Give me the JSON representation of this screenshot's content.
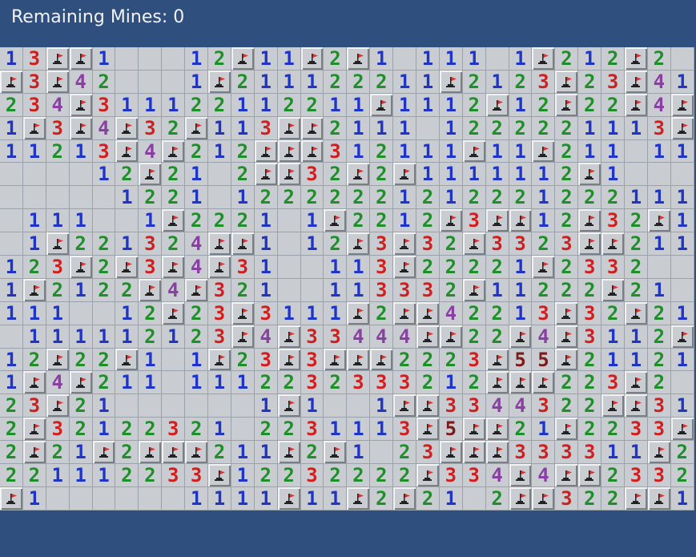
{
  "header": {
    "status_text": "Remaining Mines: 0"
  },
  "colors": {
    "background": "#2f4f7f",
    "cell_revealed": "#c9cdd1",
    "flag_red": "#e03030",
    "n1": "#1f35c7",
    "n2": "#1f8f2a",
    "n3": "#d01f1f",
    "n4": "#8a3fa3",
    "n5": "#7a1a1a"
  },
  "board": {
    "rows": 20,
    "cols": 30,
    "cells": [
      [
        "1",
        "3",
        "F",
        "F",
        "1",
        "",
        "",
        "",
        "1",
        "2",
        "F",
        "1",
        "1",
        "F",
        "2",
        "F",
        "1",
        "",
        "1",
        "1",
        "1",
        "",
        "1",
        "F",
        "2",
        "1",
        "2",
        "F",
        "2",
        ""
      ],
      [
        "F",
        "3",
        "F",
        "4",
        "2",
        "",
        "",
        "",
        "1",
        "F",
        "2",
        "1",
        "1",
        "1",
        "2",
        "2",
        "2",
        "1",
        "1",
        "F",
        "2",
        "1",
        "2",
        "3",
        "F",
        "2",
        "3",
        "F",
        "4",
        "1"
      ],
      [
        "2",
        "3",
        "4",
        "F",
        "3",
        "1",
        "1",
        "1",
        "2",
        "2",
        "1",
        "1",
        "2",
        "2",
        "1",
        "1",
        "F",
        "1",
        "1",
        "1",
        "2",
        "F",
        "1",
        "2",
        "F",
        "2",
        "2",
        "F",
        "4",
        "F"
      ],
      [
        "1",
        "F",
        "3",
        "F",
        "4",
        "F",
        "3",
        "2",
        "F",
        "1",
        "1",
        "3",
        "F",
        "F",
        "2",
        "1",
        "1",
        "1",
        "",
        "1",
        "2",
        "2",
        "2",
        "2",
        "2",
        "1",
        "1",
        "1",
        "3",
        "F"
      ],
      [
        "1",
        "1",
        "2",
        "1",
        "3",
        "F",
        "4",
        "F",
        "2",
        "1",
        "2",
        "F",
        "F",
        "F",
        "3",
        "1",
        "2",
        "1",
        "1",
        "1",
        "F",
        "1",
        "1",
        "F",
        "2",
        "1",
        "1",
        "",
        "1",
        "1"
      ],
      [
        "",
        "",
        "",
        "",
        "1",
        "2",
        "F",
        "2",
        "1",
        "",
        "2",
        "F",
        "F",
        "3",
        "2",
        "F",
        "2",
        "F",
        "1",
        "1",
        "1",
        "1",
        "1",
        "1",
        "2",
        "F",
        "1",
        "",
        "",
        ""
      ],
      [
        "",
        "",
        "",
        "",
        "",
        "1",
        "2",
        "2",
        "1",
        "",
        "1",
        "2",
        "2",
        "2",
        "2",
        "2",
        "2",
        "1",
        "2",
        "1",
        "2",
        "2",
        "2",
        "1",
        "2",
        "2",
        "2",
        "1",
        "1",
        "1"
      ],
      [
        "",
        "1",
        "1",
        "1",
        "",
        "",
        "1",
        "F",
        "2",
        "2",
        "2",
        "1",
        "",
        "1",
        "F",
        "2",
        "2",
        "1",
        "2",
        "F",
        "3",
        "F",
        "F",
        "1",
        "2",
        "F",
        "3",
        "2",
        "F",
        "1"
      ],
      [
        "",
        "1",
        "F",
        "2",
        "2",
        "1",
        "3",
        "2",
        "4",
        "F",
        "F",
        "1",
        "",
        "1",
        "2",
        "F",
        "3",
        "F",
        "3",
        "2",
        "F",
        "3",
        "3",
        "2",
        "3",
        "F",
        "F",
        "2",
        "1",
        "1"
      ],
      [
        "1",
        "2",
        "3",
        "F",
        "2",
        "F",
        "3",
        "F",
        "4",
        "F",
        "3",
        "1",
        "",
        "",
        "1",
        "1",
        "3",
        "F",
        "2",
        "2",
        "2",
        "2",
        "1",
        "F",
        "2",
        "3",
        "3",
        "2",
        "",
        ""
      ],
      [
        "1",
        "F",
        "2",
        "1",
        "2",
        "2",
        "F",
        "4",
        "F",
        "3",
        "2",
        "1",
        "",
        "",
        "1",
        "1",
        "3",
        "3",
        "3",
        "2",
        "F",
        "1",
        "1",
        "2",
        "2",
        "2",
        "F",
        "2",
        "1",
        ""
      ],
      [
        "1",
        "1",
        "1",
        "",
        "",
        "1",
        "2",
        "F",
        "2",
        "3",
        "F",
        "3",
        "1",
        "1",
        "1",
        "F",
        "2",
        "F",
        "F",
        "4",
        "2",
        "2",
        "1",
        "3",
        "F",
        "3",
        "2",
        "F",
        "2",
        "1"
      ],
      [
        "",
        "1",
        "1",
        "1",
        "1",
        "1",
        "2",
        "1",
        "2",
        "3",
        "F",
        "4",
        "F",
        "3",
        "3",
        "4",
        "4",
        "4",
        "F",
        "F",
        "2",
        "2",
        "F",
        "4",
        "F",
        "3",
        "1",
        "1",
        "2",
        "F"
      ],
      [
        "1",
        "2",
        "F",
        "2",
        "2",
        "F",
        "1",
        "",
        "1",
        "F",
        "2",
        "3",
        "F",
        "3",
        "F",
        "F",
        "F",
        "2",
        "2",
        "2",
        "3",
        "F",
        "5",
        "5",
        "F",
        "2",
        "1",
        "1",
        "2",
        "1"
      ],
      [
        "1",
        "F",
        "4",
        "F",
        "2",
        "1",
        "1",
        "",
        "1",
        "1",
        "1",
        "2",
        "2",
        "3",
        "2",
        "3",
        "3",
        "3",
        "2",
        "1",
        "2",
        "F",
        "F",
        "F",
        "2",
        "2",
        "3",
        "F",
        "2",
        ""
      ],
      [
        "2",
        "3",
        "F",
        "2",
        "1",
        "",
        "",
        "",
        "",
        "",
        "",
        "1",
        "F",
        "1",
        "",
        "",
        "1",
        "F",
        "F",
        "3",
        "3",
        "4",
        "4",
        "3",
        "2",
        "2",
        "F",
        "F",
        "3",
        "1"
      ],
      [
        "2",
        "F",
        "3",
        "2",
        "1",
        "2",
        "2",
        "3",
        "2",
        "1",
        "",
        "2",
        "2",
        "3",
        "1",
        "1",
        "1",
        "3",
        "F",
        "5",
        "F",
        "F",
        "2",
        "1",
        "F",
        "2",
        "2",
        "3",
        "3",
        "F"
      ],
      [
        "2",
        "F",
        "2",
        "1",
        "F",
        "2",
        "F",
        "F",
        "F",
        "2",
        "1",
        "1",
        "F",
        "2",
        "F",
        "1",
        "",
        "2",
        "3",
        "F",
        "F",
        "F",
        "3",
        "3",
        "3",
        "3",
        "1",
        "1",
        "F",
        "2"
      ],
      [
        "2",
        "2",
        "1",
        "1",
        "1",
        "2",
        "2",
        "3",
        "3",
        "F",
        "1",
        "2",
        "2",
        "3",
        "2",
        "2",
        "2",
        "2",
        "F",
        "3",
        "3",
        "4",
        "F",
        "4",
        "F",
        "F",
        "2",
        "3",
        "3",
        "2"
      ],
      [
        "F",
        "1",
        "",
        "",
        "",
        "",
        "",
        "",
        "1",
        "1",
        "1",
        "1",
        "F",
        "1",
        "1",
        "F",
        "2",
        "F",
        "2",
        "1",
        "",
        "2",
        "F",
        "F",
        "3",
        "2",
        "2",
        "F",
        "F",
        "1"
      ]
    ]
  }
}
